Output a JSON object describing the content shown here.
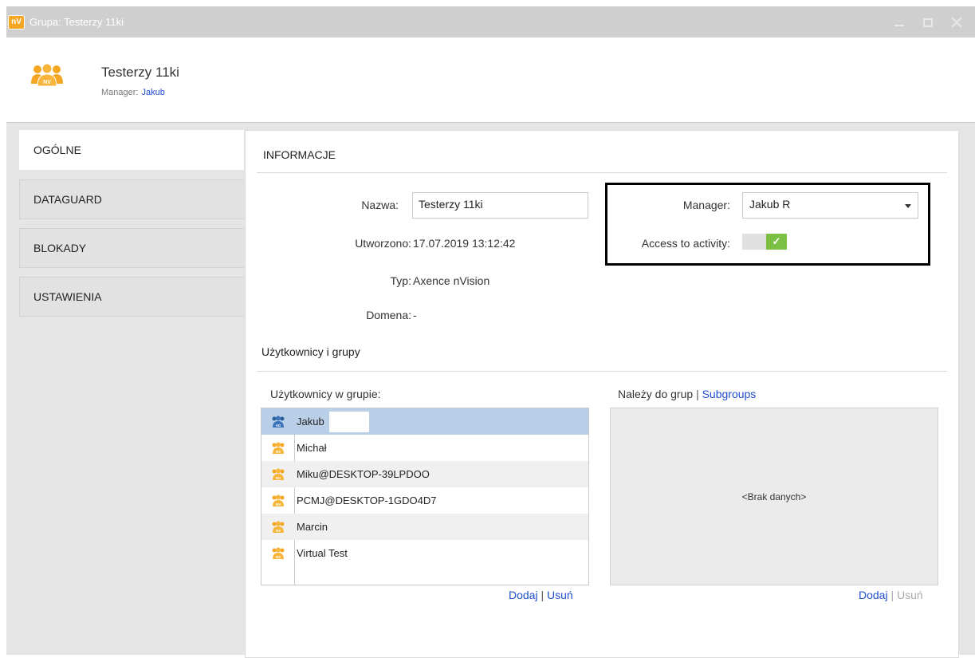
{
  "window": {
    "logo_text": "nV",
    "title": "Grupa: Testerzy 11ki"
  },
  "header": {
    "group_name": "Testerzy 11ki",
    "manager_label": "Manager:",
    "manager_value": "Jakub"
  },
  "nav": {
    "items": [
      {
        "label": "OGÓLNE",
        "active": true
      },
      {
        "label": "DATAGUARD",
        "active": false
      },
      {
        "label": "BLOKADY",
        "active": false
      },
      {
        "label": "USTAWIENIA",
        "active": false
      }
    ]
  },
  "info": {
    "section_title": "INFORMACJE",
    "name_label": "Nazwa:",
    "name_value": "Testerzy 11ki",
    "created_label": "Utworzono:",
    "created_value": "17.07.2019 13:12:42",
    "type_label": "Typ:",
    "type_value": "Axence nVision",
    "domain_label": "Domena:",
    "domain_value": "-",
    "manager_label": "Manager:",
    "manager_value": "Jakub R",
    "access_label": "Access to activity:",
    "access_enabled": true,
    "check_glyph": "✓"
  },
  "users_section": {
    "title": "Użytkownicy i grupy",
    "members_label": "Użytkownicy w grupie:",
    "members": [
      {
        "name": "Jakub",
        "icon": "ad-user-group-icon",
        "selected": true
      },
      {
        "name": "Michał",
        "icon": "nv-user-group-icon",
        "selected": false
      },
      {
        "name": "Miku@DESKTOP-39LPDOO",
        "icon": "nv-user-group-icon",
        "selected": false
      },
      {
        "name": "PCMJ@DESKTOP-1GDO4D7",
        "icon": "nv-user-group-icon",
        "selected": false
      },
      {
        "name": "Marcin",
        "icon": "nv-user-group-icon",
        "selected": false
      },
      {
        "name": "Virtual Test",
        "icon": "nv-user-group-icon",
        "selected": false
      }
    ],
    "members_add": "Dodaj",
    "members_remove": "Usuń",
    "separator": "|",
    "belongs_label": "Należy do grup",
    "subgroups_link": "Subgroups",
    "no_data": "<Brak danych>",
    "groups_add": "Dodaj",
    "groups_remove": "Usuń"
  },
  "colors": {
    "accent_blue": "#1f4fd0",
    "icon_orange": "#f5a623",
    "ad_blue": "#2a5f9e",
    "toggle_green": "#7bc043",
    "selection": "#b9cfe7"
  }
}
